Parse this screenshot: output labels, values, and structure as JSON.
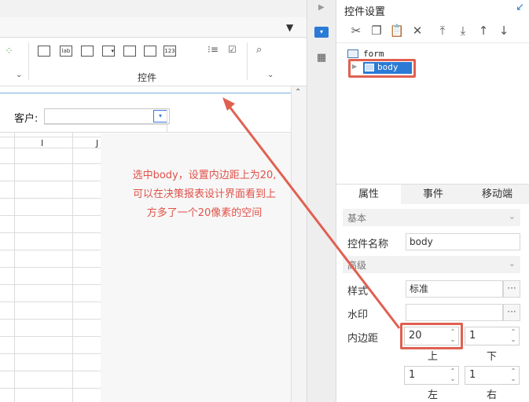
{
  "ribbon": {
    "group_label": "控件"
  },
  "canvas": {
    "customer_label": "客户:",
    "col_i": "I",
    "col_j": "J"
  },
  "annotation": {
    "line1": "选中body，设置内边距上为20,",
    "line2": "可以在决策报表设计界面看到上",
    "line3": "方多了一个20像素的空间"
  },
  "panel": {
    "title": "控件设置",
    "tree": {
      "root": "form",
      "child": "body"
    },
    "tabs": [
      "属性",
      "事件",
      "移动端"
    ],
    "sections": {
      "basic": "基本",
      "advanced": "高级"
    },
    "fields": {
      "name_label": "控件名称",
      "name_value": "body",
      "style_label": "样式",
      "style_value": "标准",
      "watermark_label": "水印",
      "watermark_value": "",
      "padding_label": "内边距",
      "top_value": "20",
      "top_label": "上",
      "bottom_value": "1",
      "bottom_label": "下",
      "left_value": "1",
      "left_label": "左",
      "right_value": "1",
      "right_label": "右"
    }
  },
  "colors": {
    "highlight": "#e06050",
    "accent": "#1a73d9"
  }
}
